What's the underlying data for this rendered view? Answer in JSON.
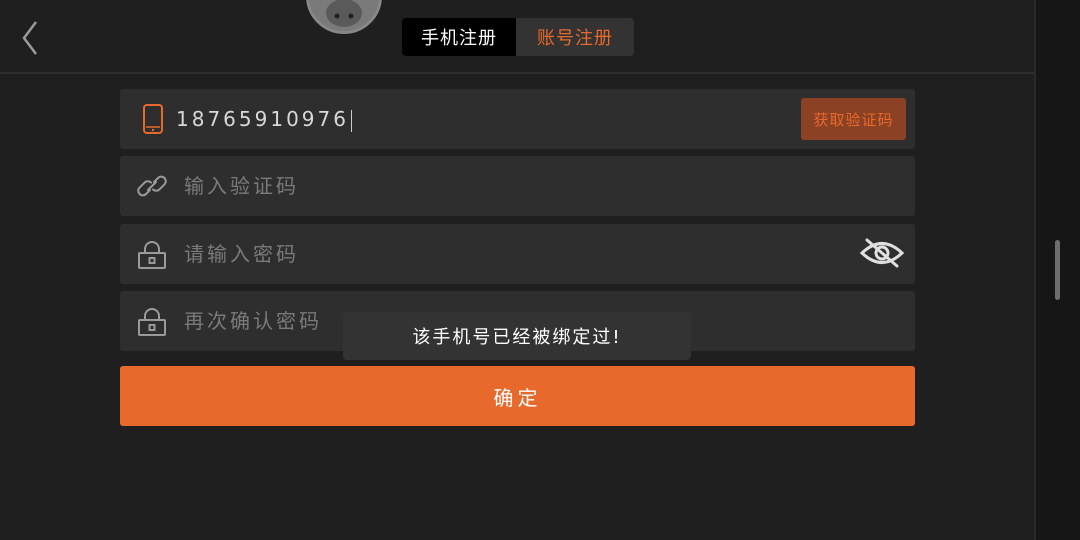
{
  "header": {
    "tabs": [
      {
        "label": "手机注册",
        "active": true
      },
      {
        "label": "账号注册",
        "active": false
      }
    ]
  },
  "form": {
    "phone": {
      "value": "18765910976",
      "icon": "phone-icon"
    },
    "get_code_label": "获取验证码",
    "code": {
      "placeholder": "输入验证码",
      "icon": "link-icon"
    },
    "password": {
      "placeholder": "请输入密码",
      "icon": "lock-icon"
    },
    "confirm_password": {
      "placeholder": "再次确认密码",
      "icon": "lock-icon"
    },
    "submit_label": "确定"
  },
  "toast": {
    "message": "该手机号已经被绑定过!"
  },
  "colors": {
    "accent": "#e8692c",
    "background": "#1f1f1f",
    "field": "#2e2e2e"
  }
}
